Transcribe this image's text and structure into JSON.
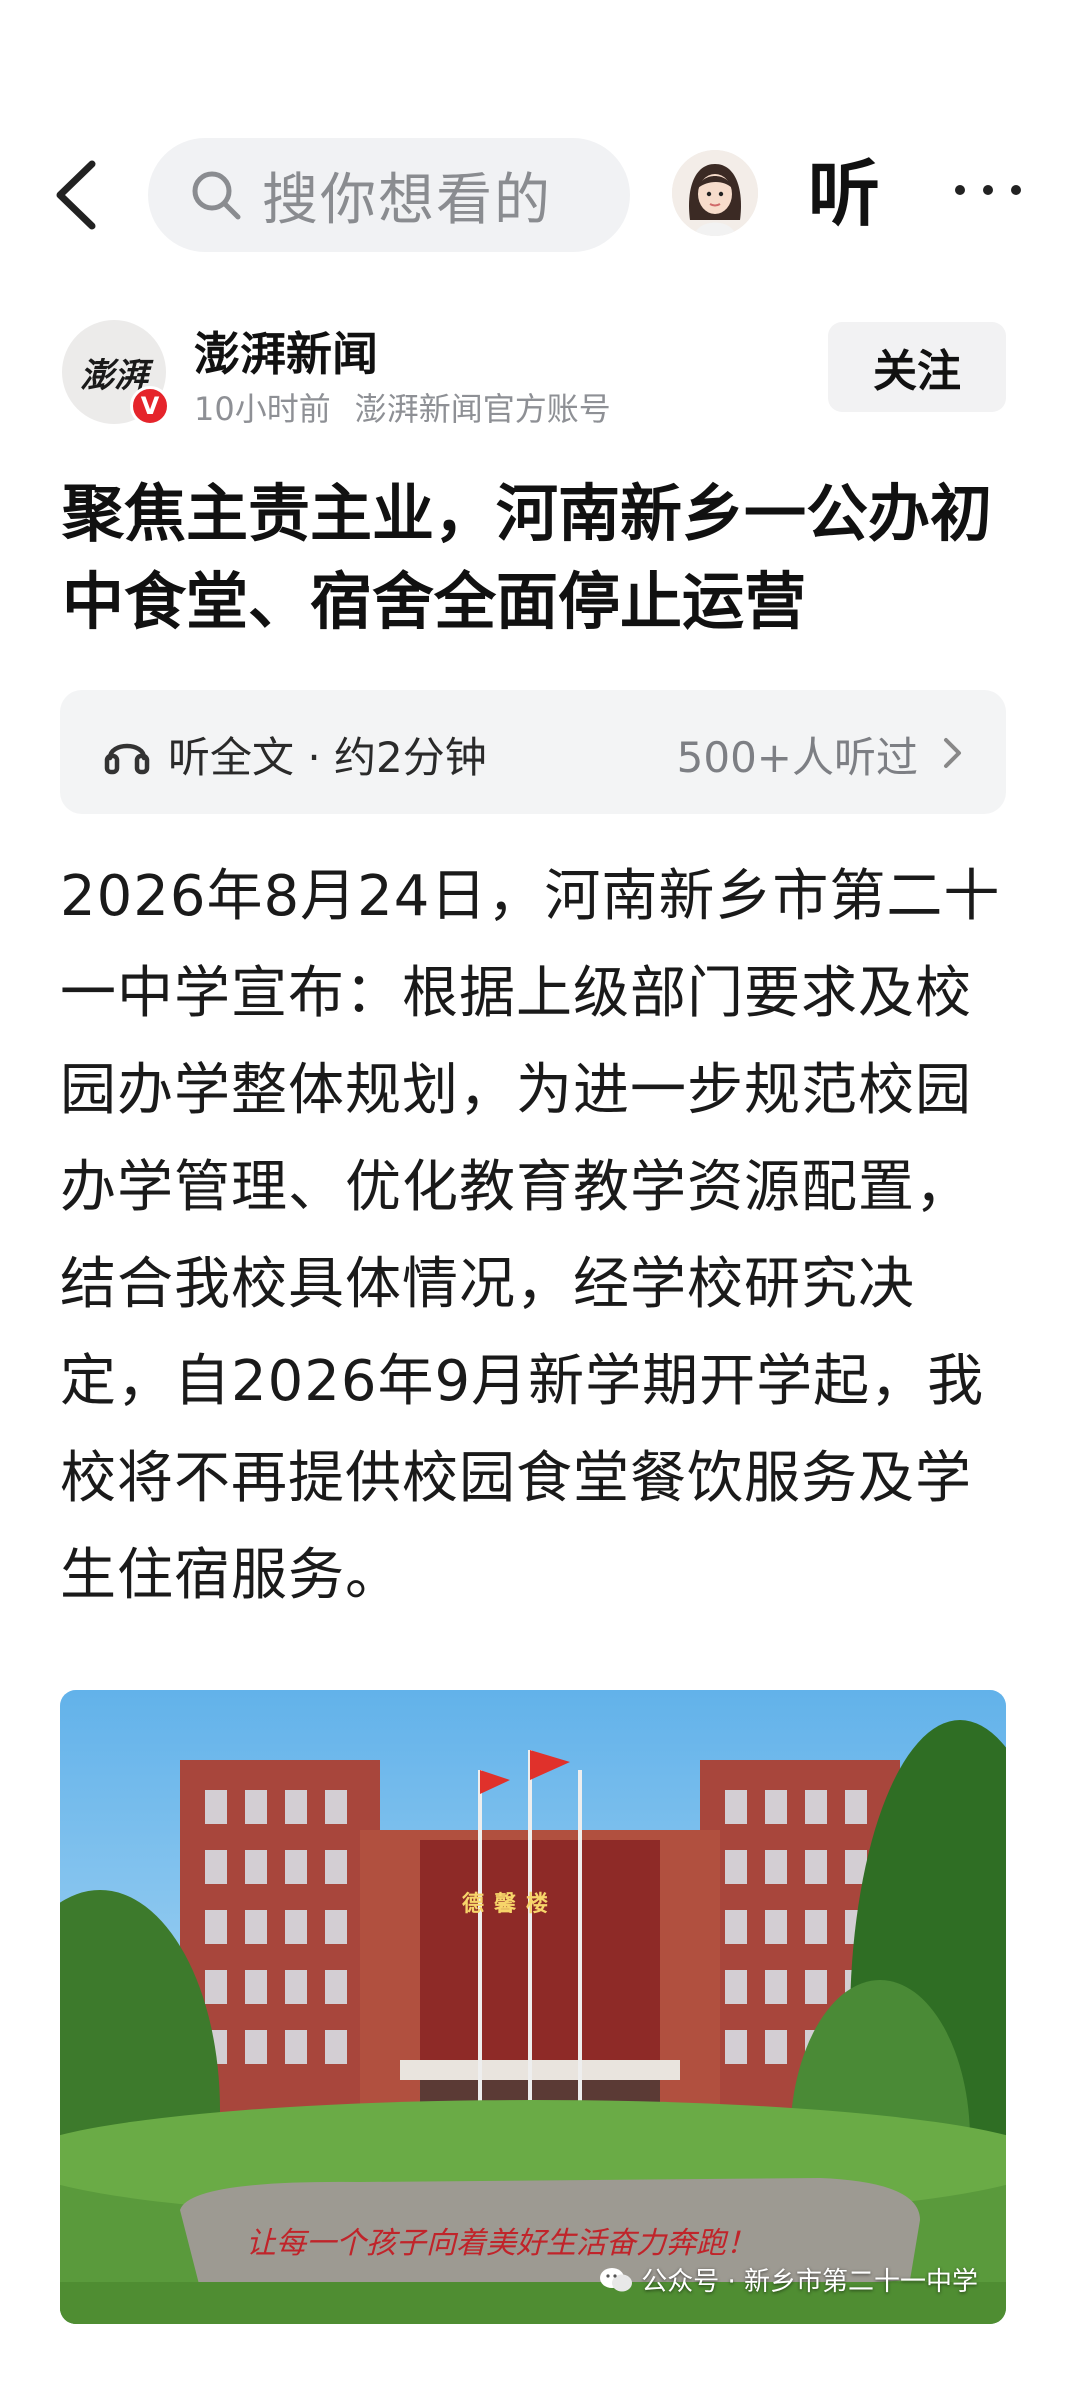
{
  "topbar": {
    "search_placeholder": "搜你想看的",
    "listen_label": "听"
  },
  "author": {
    "logo_text": "澎湃",
    "name": "澎湃新闻",
    "time": "10小时前",
    "account": "澎湃新闻官方账号",
    "follow_label": "关注",
    "verified_mark": "V"
  },
  "article": {
    "title": "聚焦主责主业，河南新乡一公办初中食堂、宿舍全面停止运营",
    "listen_text": "听全文 · 约2分钟",
    "listen_count": "500+人听过",
    "body": "2026年8月24日，河南新乡市第二十一中学宣布：根据上级部门要求及校园办学整体规划，为进一步规范校园办学管理、优化教育教学资源配置，结合我校具体情况，经学校研究决定，自2026年9月新学期开学起，我校将不再提供校园食堂餐饮服务及学生住宿服务。"
  },
  "photo": {
    "building_sign": "德馨楼",
    "stone_inscription": "让每一个孩子向着美好生活奋力奔跑！",
    "watermark": "公众号 · 新乡市第二十一中学"
  },
  "colors": {
    "accent_red": "#e5242b",
    "building_brick": "#a8463c",
    "sky": "#9fd1ef"
  },
  "icons": [
    "back-icon",
    "search-icon",
    "more-icon",
    "verified-icon",
    "headphone-icon",
    "chevron-right-icon",
    "wechat-icon"
  ]
}
